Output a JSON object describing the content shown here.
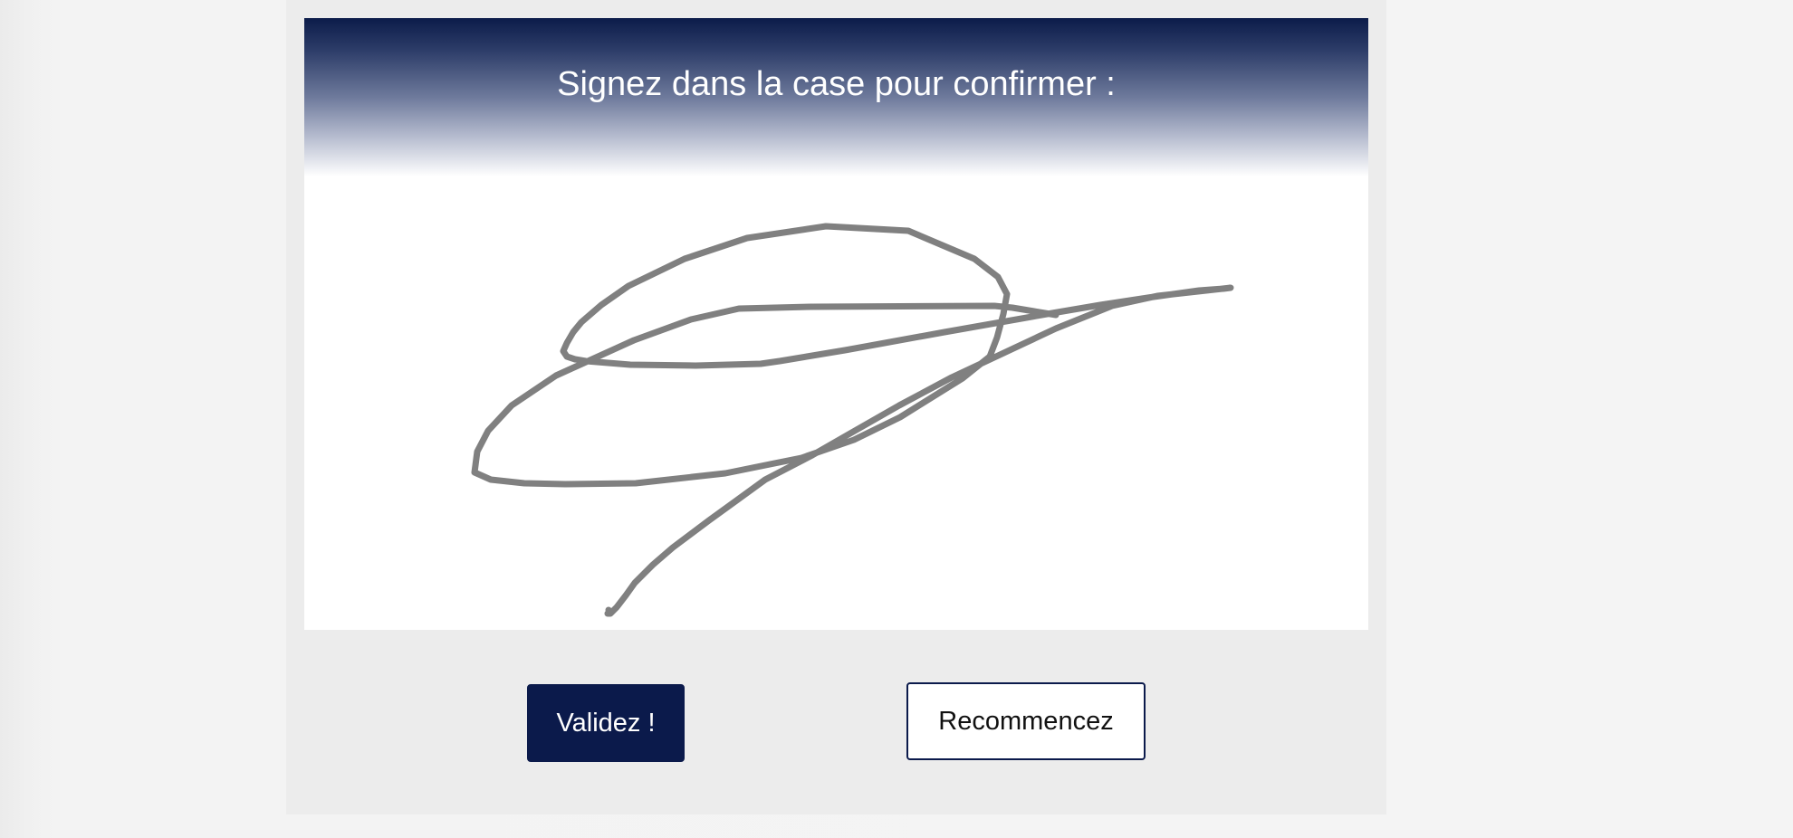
{
  "prompt": {
    "title": "Signez dans la case pour confirmer :"
  },
  "signature": {
    "stroke_color": "#808080"
  },
  "actions": {
    "validate_label": "Validez !",
    "reset_label": "Recommencez"
  },
  "colors": {
    "primary": "#0b1a4b",
    "panel_background": "#ececec"
  }
}
